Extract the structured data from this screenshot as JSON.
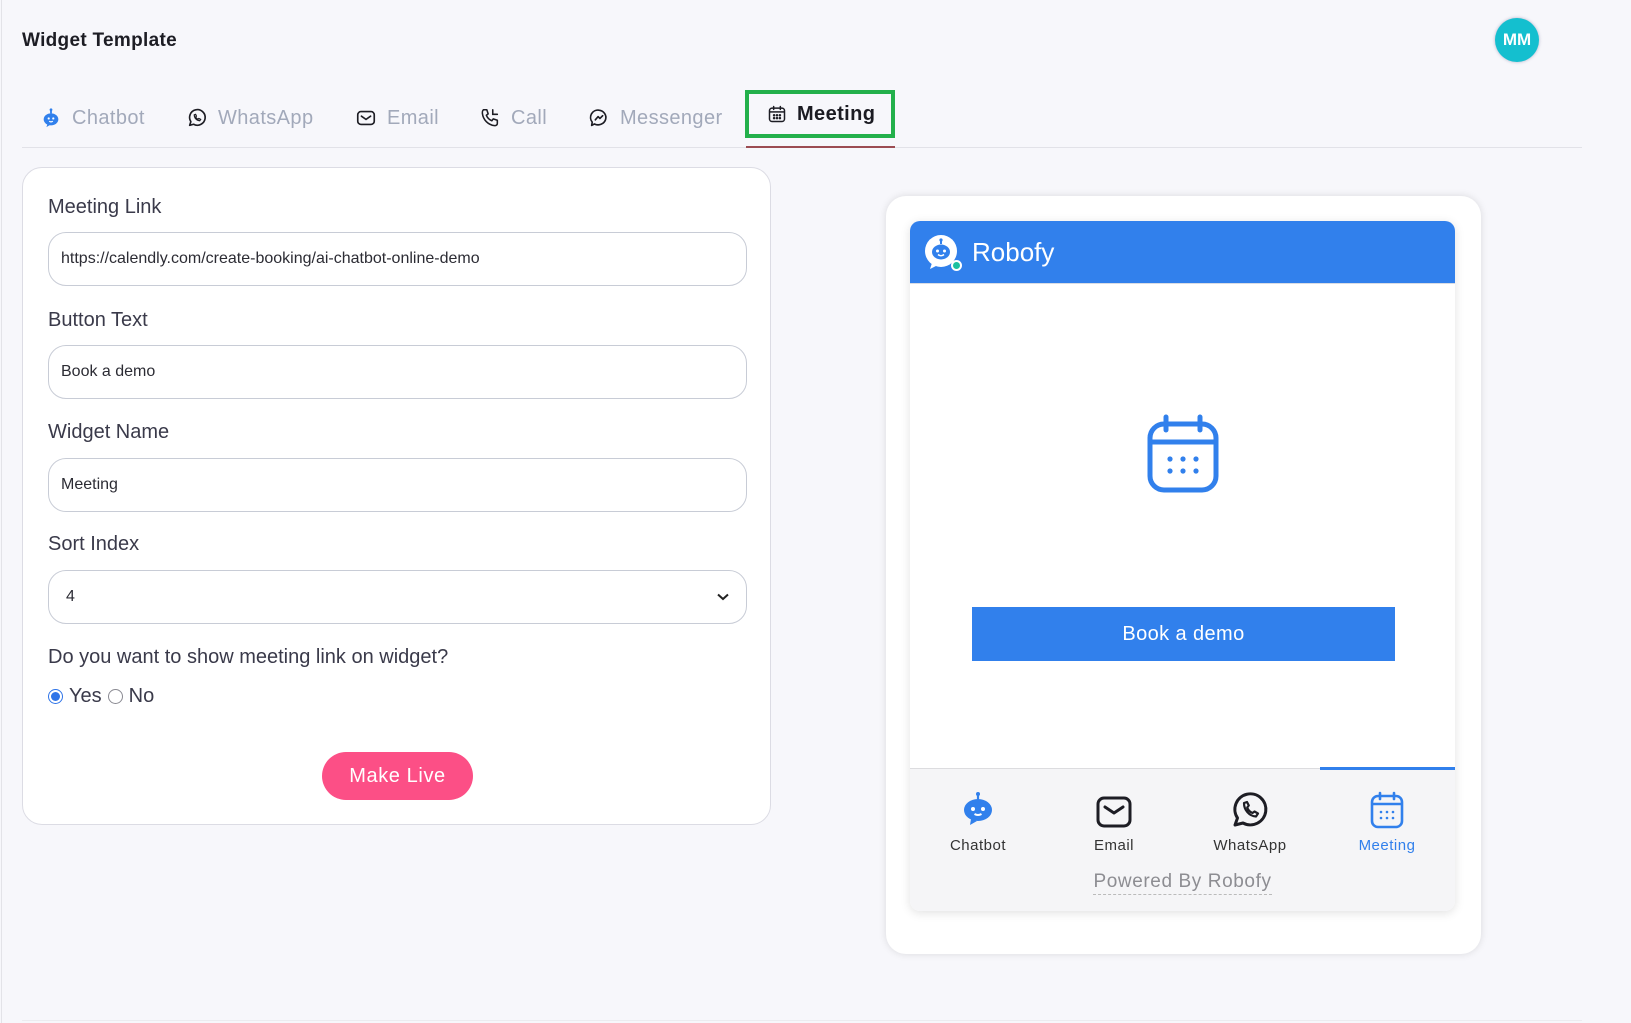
{
  "page": {
    "title": "Widget Template",
    "avatar_initials": "MM",
    "avatar_color": "#14bfcf"
  },
  "tabs": [
    {
      "label": "Chatbot",
      "icon": "chatbot-icon",
      "active": false
    },
    {
      "label": "WhatsApp",
      "icon": "whatsapp-icon",
      "active": false
    },
    {
      "label": "Email",
      "icon": "email-icon",
      "active": false
    },
    {
      "label": "Call",
      "icon": "phone-icon",
      "active": false
    },
    {
      "label": "Messenger",
      "icon": "messenger-icon",
      "active": false
    },
    {
      "label": "Meeting",
      "icon": "calendar-icon",
      "active": true
    }
  ],
  "form": {
    "meeting_link_label": "Meeting Link",
    "meeting_link_value": "https://calendly.com/create-booking/ai-chatbot-online-demo",
    "button_text_label": "Button Text",
    "button_text_value": "Book a demo",
    "widget_name_label": "Widget Name",
    "widget_name_value": "Meeting",
    "sort_index_label": "Sort Index",
    "sort_index_value": "4",
    "show_link_question": "Do you want to show meeting link on widget?",
    "radio_yes": "Yes",
    "radio_no": "No",
    "show_link_selected": "Yes",
    "make_live_label": "Make Live"
  },
  "preview": {
    "brand_name": "Robofy",
    "book_button_label": "Book a demo",
    "nav": [
      {
        "label": "Chatbot",
        "icon": "chatbot-icon",
        "active": false
      },
      {
        "label": "Email",
        "icon": "email-icon",
        "active": false
      },
      {
        "label": "WhatsApp",
        "icon": "whatsapp-icon",
        "active": false
      },
      {
        "label": "Meeting",
        "icon": "calendar-icon",
        "active": true
      }
    ],
    "powered_by": "Powered By Robofy"
  },
  "colors": {
    "accent_blue": "#3180ec",
    "make_live_pink": "#fc4f86",
    "active_tab_highlight": "#23b04b"
  }
}
